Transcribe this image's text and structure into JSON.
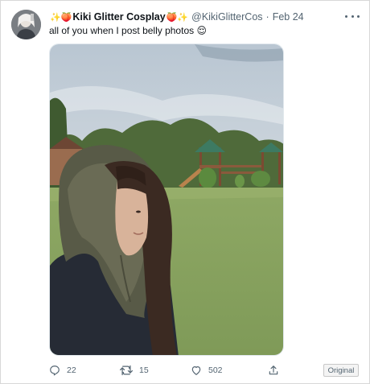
{
  "tweet": {
    "author": {
      "display_name": "Kiki Glitter Cosplay",
      "name_prefix_emoji": "✨🍑",
      "name_suffix_emoji": "🍑✨",
      "handle": "@KikiGlitterCos",
      "separator": "·",
      "date": "Feb 24"
    },
    "text": "all of you when I post belly photos 😌",
    "media": {
      "icon": "photo-of-person-in-hood"
    },
    "actions": {
      "replies": "22",
      "retweets": "15",
      "likes": "502"
    },
    "more_icon": "more-dots-icon"
  },
  "badge": {
    "label": "Original"
  },
  "colors": {
    "text_primary": "#0f1419",
    "text_secondary": "#536471",
    "border": "#d8d8d8"
  }
}
